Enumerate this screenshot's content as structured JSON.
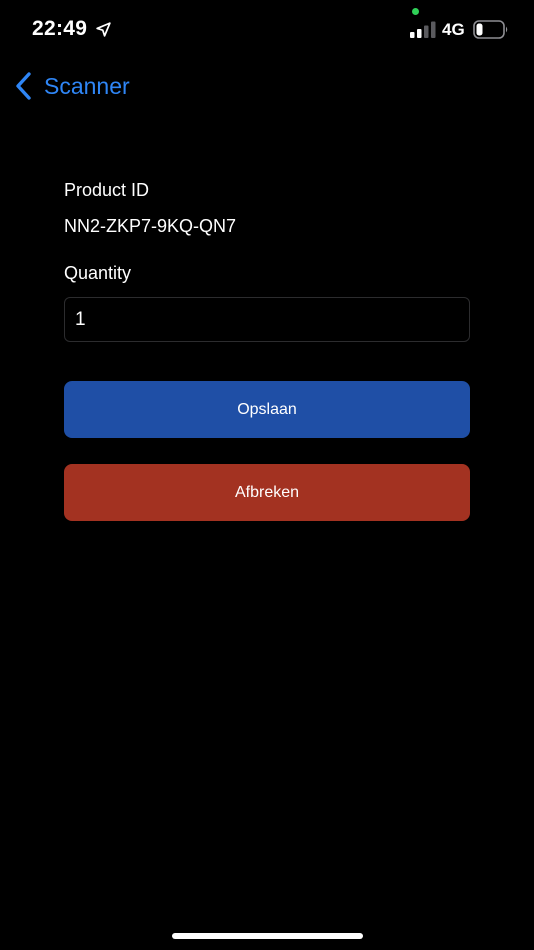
{
  "status_bar": {
    "time": "22:49",
    "network": "4G",
    "icons": [
      "location-arrow-icon",
      "signal-icon",
      "battery-icon"
    ],
    "signal_bars": 2,
    "battery_level": 0.2
  },
  "nav": {
    "back_label": "Scanner",
    "icon": "chevron-left-icon",
    "accent_color": "#2f86f6"
  },
  "form": {
    "product_id_label": "Product ID",
    "product_id_value": "NN2-ZKP7-9KQ-QN7",
    "quantity_label": "Quantity",
    "quantity_value": "1"
  },
  "buttons": {
    "save_label": "Opslaan",
    "cancel_label": "Afbreken",
    "save_color": "#1f4fa6",
    "cancel_color": "#a33221"
  }
}
